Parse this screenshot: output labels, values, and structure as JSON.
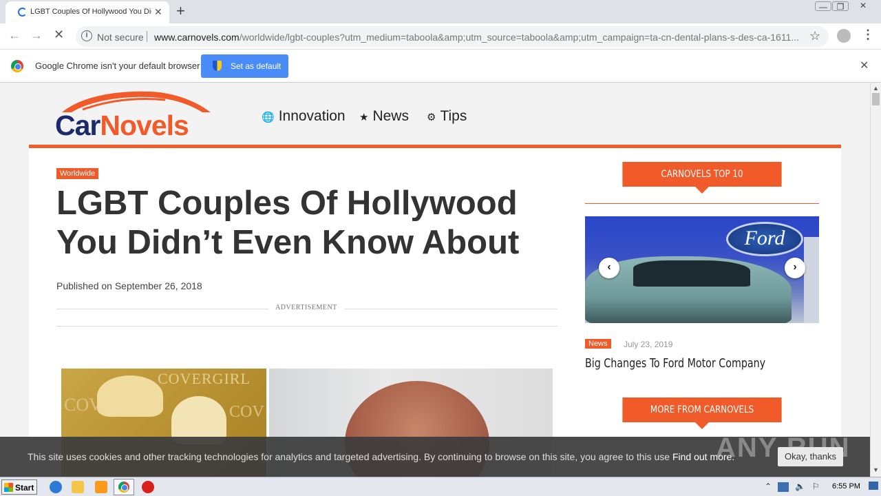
{
  "browser": {
    "tab_title": "LGBT Couples Of Hollywood You Didn't Even Know About",
    "tab_close": "✕",
    "new_tab": "+",
    "security_label": "Not secure",
    "url_host": "www.carnovels.com",
    "url_path": "/worldwide/lgbt-couples?utm_medium=taboola&amp;utm_source=taboola&amp;utm_campaign=ta-cn-dental-plans-s-des-ca-1611...",
    "window_controls": {
      "minimize": "—",
      "maximize": "❐",
      "close": "✕"
    }
  },
  "infobar": {
    "message": "Google Chrome isn't your default browser",
    "button_label": "Set as default",
    "close": "✕"
  },
  "site": {
    "logo_car": "Car",
    "logo_novels": "Novels",
    "nav": [
      {
        "label": "Innovation",
        "icon": "globe-icon",
        "glyph": "🌐"
      },
      {
        "label": "News",
        "icon": "star-icon",
        "glyph": "★"
      },
      {
        "label": "Tips",
        "icon": "gears-icon",
        "glyph": "⚙"
      }
    ]
  },
  "article": {
    "category": "Worldwide",
    "headline": "LGBT Couples Of Hollywood You Didn’t Even Know About",
    "published": "Published on September 26, 2018",
    "ad_label": "ADVERTISEMENT",
    "photo_text_top": "COVERGIRL",
    "photo_text_left": "COV",
    "photo_text_right": "COV"
  },
  "sidebar": {
    "top10_title": "CARNOVELS TOP 10",
    "slide": {
      "brand": "Ford",
      "prev": "‹",
      "next": "›",
      "category": "News",
      "date": "July 23, 2019",
      "title": "Big Changes To Ford Motor Company"
    },
    "more_title": "MORE FROM CARNOVELS"
  },
  "cookie": {
    "text": "This site uses cookies and other tracking technologies for analytics and targeted advertising. By continuing to browse on this site, you agree to this use",
    "link": "Find out more.",
    "button": "Okay, thanks",
    "watermark": "ANY RUN"
  },
  "taskbar": {
    "start": "Start",
    "clock": "6:55 PM"
  },
  "colors": {
    "accent": "#f15a29",
    "logo_blue": "#1b2a6b",
    "chrome_button": "#4a8cf7"
  }
}
